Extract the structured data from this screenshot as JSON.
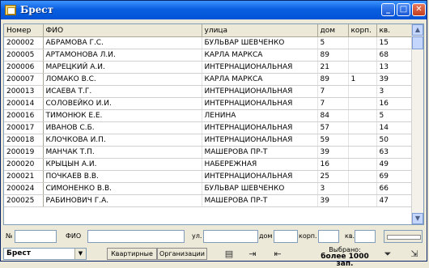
{
  "window": {
    "title": "Брест"
  },
  "table": {
    "columns": [
      "Номер",
      "ФИО",
      "улица",
      "дом",
      "корп.",
      "кв."
    ],
    "rows": [
      [
        "200002",
        "АБРАМОВА Г.С.",
        "БУЛЬВАР ШЕВЧЕНКО",
        "5",
        "",
        "15"
      ],
      [
        "200005",
        "АРТАМОНОВА Л.И.",
        "КАРЛА МАРКСА",
        "89",
        "",
        "68"
      ],
      [
        "200006",
        "МАРЕЦКИЙ А.И.",
        "ИНТЕРНАЦИОНАЛЬНАЯ",
        "21",
        "",
        "13"
      ],
      [
        "200007",
        "ЛОМАКО В.С.",
        "КАРЛА МАРКСА",
        "89",
        "1",
        "39"
      ],
      [
        "200013",
        "ИСАЕВА Т.Г.",
        "ИНТЕРНАЦИОНАЛЬНАЯ",
        "7",
        "",
        "3"
      ],
      [
        "200014",
        "СОЛОВЕЙКО И.И.",
        "ИНТЕРНАЦИОНАЛЬНАЯ",
        "7",
        "",
        "16"
      ],
      [
        "200016",
        "ТИМОНЮК Е.Е.",
        "ЛЕНИНА",
        "84",
        "",
        "5"
      ],
      [
        "200017",
        "ИВАНОВ С.Б.",
        "ИНТЕРНАЦИОНАЛЬНАЯ",
        "57",
        "",
        "14"
      ],
      [
        "200018",
        "КЛОЧКОВА И.П.",
        "ИНТЕРНАЦИОНАЛЬНАЯ",
        "59",
        "",
        "50"
      ],
      [
        "200019",
        "МАНЧАК Т.П.",
        "МАШЕРОВА ПР-Т",
        "39",
        "",
        "63"
      ],
      [
        "200020",
        "КРЫЦЫН А.И.",
        "НАБЕРЕЖНАЯ",
        "16",
        "",
        "49"
      ],
      [
        "200021",
        "ПОЧКАЕВ В.В.",
        "ИНТЕРНАЦИОНАЛЬНАЯ",
        "25",
        "",
        "69"
      ],
      [
        "200024",
        "СИМОНЕНКО В.В.",
        "БУЛЬВАР ШЕВЧЕНКО",
        "3",
        "",
        "66"
      ],
      [
        "200025",
        "РАБИНОВИЧ Г.А.",
        "МАШЕРОВА ПР-Т",
        "39",
        "",
        "47"
      ]
    ]
  },
  "filters": {
    "num": "№",
    "fio": "ФИО",
    "street": "ул.",
    "house": "дом",
    "corp": "корп.",
    "apt": "кв."
  },
  "status": {
    "city": "Брест",
    "btn_apartments": "Квартирные",
    "btn_orgs": "Организации",
    "selected_label": "Выбрано:",
    "selected_value": "более 1000 зап."
  },
  "icons": {
    "save": "disk-icon",
    "nav1": "doc-arrow-icon",
    "nav2": "doc-back-icon",
    "filter": "funnel-icon",
    "exit": "exit-icon"
  }
}
